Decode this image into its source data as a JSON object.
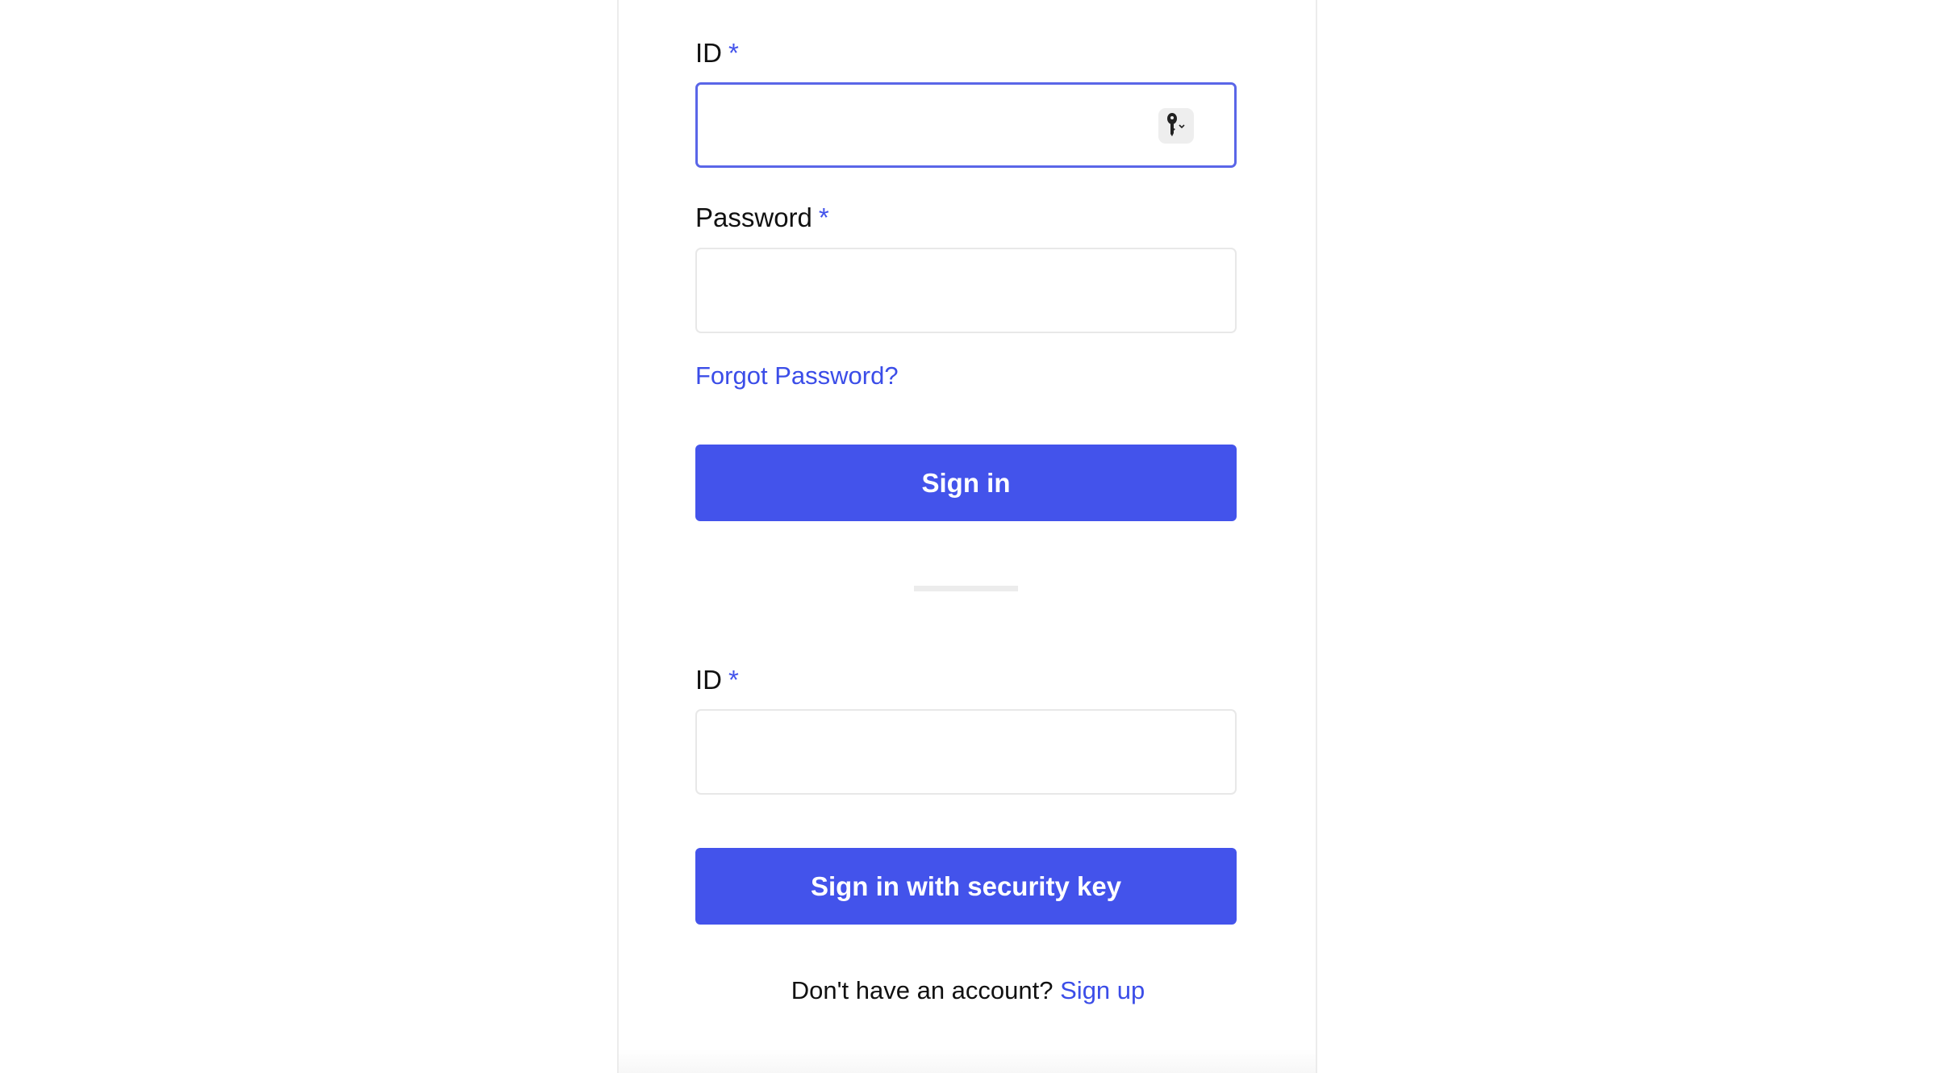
{
  "form1": {
    "id_label": "ID",
    "id_required": "*",
    "id_value": "",
    "password_label": "Password",
    "password_required": "*",
    "password_value": "",
    "forgot_password": "Forgot Password?",
    "sign_in_button": "Sign in"
  },
  "form2": {
    "id_label": "ID",
    "id_required": "*",
    "id_value": "",
    "security_key_button": "Sign in with security key"
  },
  "footer": {
    "prompt": "Don't have an account?",
    "signup_link": "Sign up"
  },
  "icons": {
    "password_manager": "key-icon",
    "dropdown": "chevron-down-icon"
  },
  "colors": {
    "accent": "#4353eb",
    "link": "#3b4de8",
    "focus_border": "#5a66e8"
  }
}
